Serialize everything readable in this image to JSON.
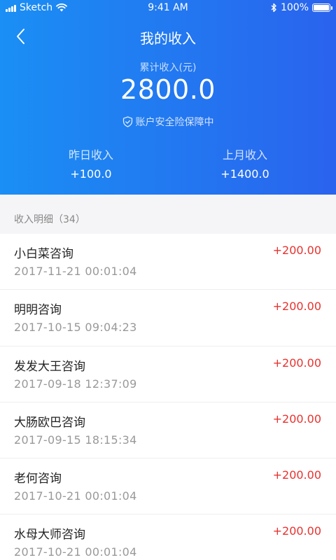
{
  "status_bar": {
    "carrier": "Sketch",
    "time": "9:41 AM",
    "battery": "100%"
  },
  "nav": {
    "title": "我的收入"
  },
  "summary": {
    "total_label": "累计收入(元)",
    "total_value": "2800.0",
    "safety_text": "账户安全险保障中",
    "yesterday_label": "昨日收入",
    "yesterday_value": "+100.0",
    "last_month_label": "上月收入",
    "last_month_value": "+1400.0"
  },
  "details": {
    "title": "收入明细（34）",
    "items": [
      {
        "name": "小白菜咨询",
        "date": "2017-11-21   00:01:04",
        "amount": "+200.00"
      },
      {
        "name": "明明咨询",
        "date": "2017-10-15   09:04:23",
        "amount": "+200.00"
      },
      {
        "name": "发发大王咨询",
        "date": "2017-09-18   12:37:09",
        "amount": "+200.00"
      },
      {
        "name": "大肠欧巴咨询",
        "date": "2017-09-15   18:15:34",
        "amount": "+200.00"
      },
      {
        "name": "老何咨询",
        "date": "2017-10-21   00:01:04",
        "amount": "+200.00"
      },
      {
        "name": "水母大师咨询",
        "date": "2017-10-21   00:01:04",
        "amount": "+200.00"
      }
    ]
  },
  "icons": {
    "back": "chevron-left-icon",
    "shield": "shield-check-icon",
    "wifi": "wifi-icon",
    "bluetooth": "bluetooth-icon",
    "signal": "signal-icon",
    "battery": "battery-icon"
  },
  "colors": {
    "header_gradient_start": "#1a8ff4",
    "header_gradient_end": "#2a63ee",
    "amount": "#e8322e"
  }
}
